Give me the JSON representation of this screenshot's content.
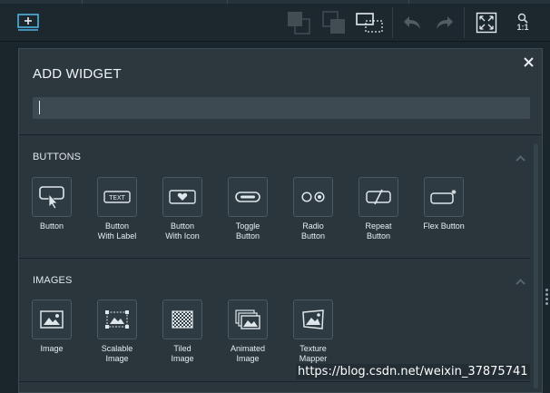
{
  "toolbar": {
    "zoom_label": "1:1"
  },
  "dialog": {
    "title": "ADD WIDGET",
    "search_value": ""
  },
  "sections": {
    "buttons": {
      "title": "BUTTONS",
      "items": [
        {
          "label": "Button",
          "icon": "button-icon"
        },
        {
          "label": "Button\nWith Label",
          "icon": "button-with-label-icon"
        },
        {
          "label": "Button\nWith Icon",
          "icon": "button-with-icon-icon"
        },
        {
          "label": "Toggle\nButton",
          "icon": "toggle-button-icon"
        },
        {
          "label": "Radio\nButton",
          "icon": "radio-button-icon"
        },
        {
          "label": "Repeat\nButton",
          "icon": "repeat-button-icon"
        },
        {
          "label": "Flex Button",
          "icon": "flex-button-icon"
        }
      ]
    },
    "images": {
      "title": "IMAGES",
      "items": [
        {
          "label": "Image",
          "icon": "image-icon"
        },
        {
          "label": "Scalable\nImage",
          "icon": "scalable-image-icon"
        },
        {
          "label": "Tiled\nImage",
          "icon": "tiled-image-icon"
        },
        {
          "label": "Animated\nImage",
          "icon": "animated-image-icon"
        },
        {
          "label": "Texture\nMapper",
          "icon": "texture-mapper-icon"
        }
      ]
    }
  },
  "icon_texts": {
    "label_chip": "TEXT"
  },
  "watermark": "https://blog.csdn.net/weixin_37875741",
  "colors": {
    "background": "#1b252c",
    "dialog": "#2a353c",
    "accent": "#4fb2e0"
  }
}
